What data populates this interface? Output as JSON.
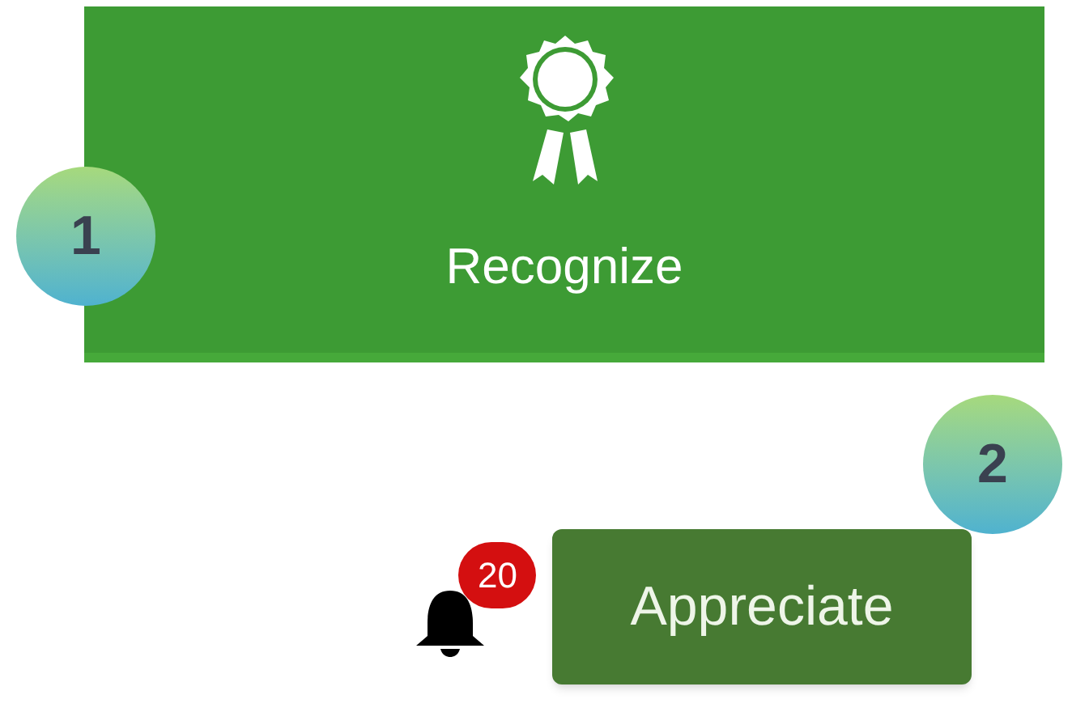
{
  "recognize_tile": {
    "label": "Recognize"
  },
  "notifications": {
    "count": "20"
  },
  "appreciate_button": {
    "label": "Appreciate"
  },
  "callouts": [
    {
      "number": "1"
    },
    {
      "number": "2"
    }
  ]
}
